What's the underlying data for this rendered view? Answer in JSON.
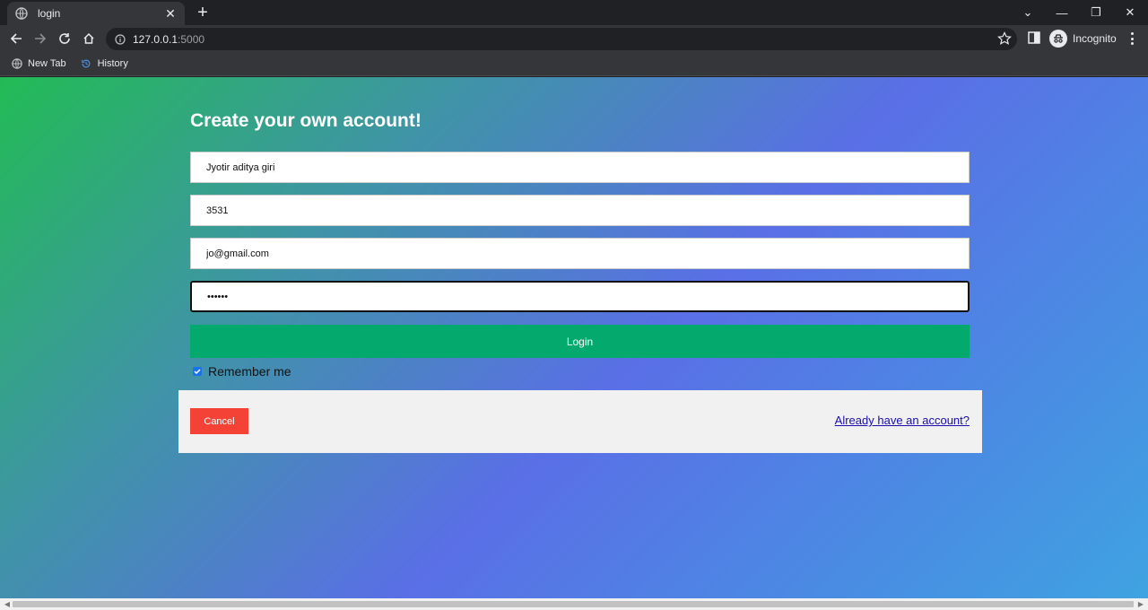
{
  "browser": {
    "tab_title": "login",
    "tab_close": "✕",
    "new_tab": "+",
    "url_host": "127.0.0.1",
    "url_port": ":5000",
    "profile_label": "Incognito",
    "window_controls": {
      "tab_search": "⌄",
      "minimize": "—",
      "restore": "❐",
      "close": "✕"
    },
    "bookmarks": [
      {
        "label": "New Tab",
        "icon": "globe-icon"
      },
      {
        "label": "History",
        "icon": "history-icon"
      }
    ]
  },
  "page": {
    "heading": "Create your own account!",
    "fields": {
      "name": "Jyotir aditya giri",
      "number": "3531",
      "email": "jo@gmail.com",
      "password": "••••••"
    },
    "login_label": "Login",
    "remember_label": "Remember me",
    "remember_checked": true,
    "cancel_label": "Cancel",
    "account_link": "Already have an account?",
    "colors": {
      "login": "#04aa6d",
      "cancel": "#f44336",
      "link": "#1a0dab",
      "footer": "#f1f1f1"
    }
  }
}
